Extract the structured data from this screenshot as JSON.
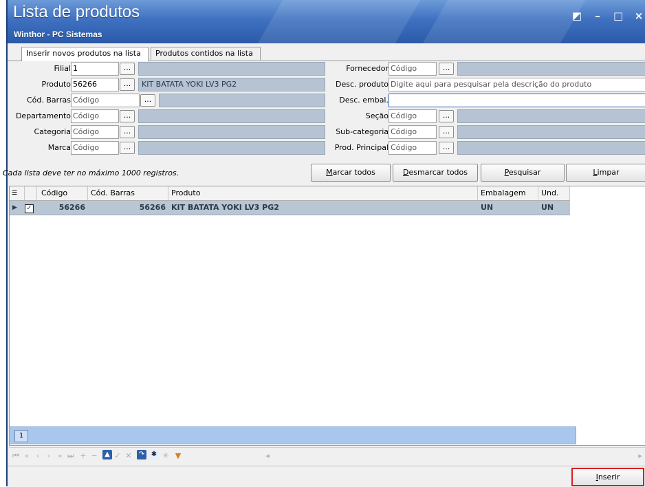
{
  "window": {
    "title": "Lista de produtos",
    "subtitle": "Winthor - PC Sistemas",
    "controls": [
      "◩",
      "–",
      "□",
      "×"
    ]
  },
  "tabs": [
    "Inserir novos produtos na lista",
    "Produtos contidos na lista"
  ],
  "form": {
    "filial": {
      "label": "Filial",
      "value": "1"
    },
    "produto": {
      "label": "Produto",
      "value": "56266",
      "desc": "KIT BATATA YOKI LV3 PG2"
    },
    "cod_barras": {
      "label": "Cód. Barras",
      "placeholder": "Código"
    },
    "departamento": {
      "label": "Departamento",
      "placeholder": "Código"
    },
    "categoria": {
      "label": "Categoria",
      "placeholder": "Código"
    },
    "marca": {
      "label": "Marca",
      "placeholder": "Código"
    },
    "fornecedor": {
      "label": "Fornecedor",
      "placeholder": "Código"
    },
    "desc_produto": {
      "label": "Desc. produto",
      "placeholder": "Digite aqui para pesquisar pela descrição do produto"
    },
    "desc_embal": {
      "label": "Desc. embal.",
      "value": ""
    },
    "secao": {
      "label": "Seção",
      "placeholder": "Código"
    },
    "subcategoria": {
      "label": "Sub-categoria",
      "placeholder": "Código"
    },
    "prod_principal": {
      "label": "Prod. Principal",
      "placeholder": "Código"
    },
    "dots": "..."
  },
  "note": "Cada lista deve ter no máximo 1000 registros.",
  "buttons": {
    "marcar": {
      "u": "M",
      "rest": "arcar todos"
    },
    "desmarcar": {
      "u": "D",
      "rest": "esmarcar todos"
    },
    "pesquisar": {
      "u": "P",
      "rest": "esquisar"
    },
    "limpar": {
      "u": "L",
      "rest": "impar"
    },
    "inserir": {
      "u": "I",
      "rest": "nserir"
    }
  },
  "grid": {
    "columns": [
      "Código",
      "Cód. Barras",
      "Produto",
      "Embalagem",
      "Und."
    ],
    "rows": [
      {
        "checked": true,
        "codigo": "56266",
        "cod_barras": "56266",
        "produto": "KIT BATATA YOKI LV3 PG2",
        "embalagem": "UN",
        "und": "UN"
      }
    ]
  },
  "pager": {
    "page": "1"
  },
  "colors": {
    "title_bar": "#3f71c0",
    "selected_row": "#b9c6d4",
    "pager": "#a9c6ec",
    "highlight": "#d62020"
  }
}
